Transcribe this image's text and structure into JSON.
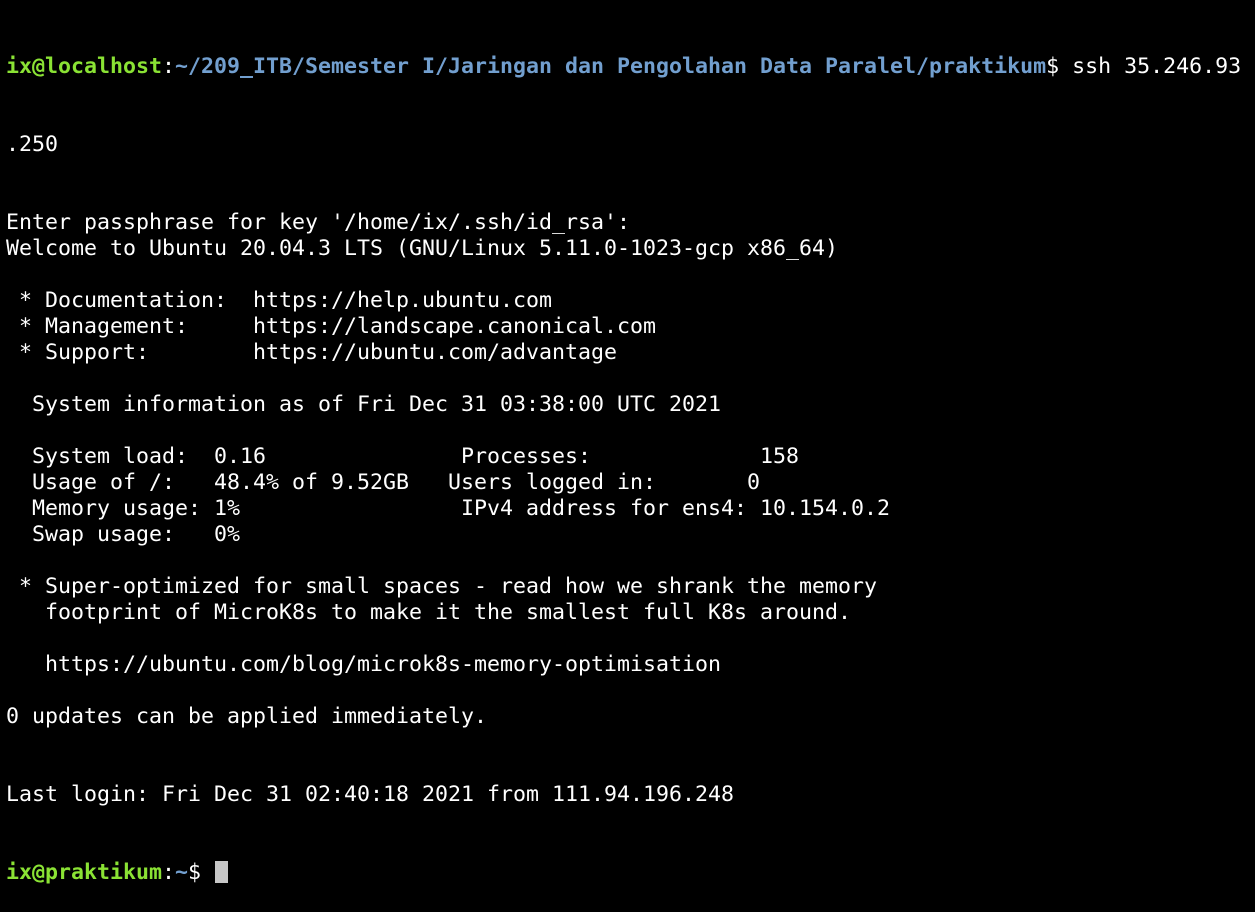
{
  "colors": {
    "background": "#000000",
    "foreground": "#ffffff",
    "prompt_user": "#8ae234",
    "prompt_path": "#729fcf",
    "cursor": "#c7c7c7"
  },
  "terminal": {
    "first_prompt": {
      "user_host": "ix@localhost",
      "separator": ":",
      "path": "~/209_ITB/Semester I/Jaringan dan Pengolahan Data Paralel/praktikum",
      "symbol": "$ ",
      "command": "ssh 35.246.93",
      "command_wrap": ".250"
    },
    "output_lines": [
      "Enter passphrase for key '/home/ix/.ssh/id_rsa':",
      "Welcome to Ubuntu 20.04.3 LTS (GNU/Linux 5.11.0-1023-gcp x86_64)",
      "",
      " * Documentation:  https://help.ubuntu.com",
      " * Management:     https://landscape.canonical.com",
      " * Support:        https://ubuntu.com/advantage",
      "",
      "  System information as of Fri Dec 31 03:38:00 UTC 2021",
      "",
      "  System load:  0.16               Processes:             158",
      "  Usage of /:   48.4% of 9.52GB   Users logged in:       0",
      "  Memory usage: 1%                 IPv4 address for ens4: 10.154.0.2",
      "  Swap usage:   0%",
      "",
      " * Super-optimized for small spaces - read how we shrank the memory",
      "   footprint of MicroK8s to make it the smallest full K8s around.",
      "",
      "   https://ubuntu.com/blog/microk8s-memory-optimisation",
      "",
      "0 updates can be applied immediately.",
      "",
      "",
      "Last login: Fri Dec 31 02:40:18 2021 from 111.94.196.248"
    ],
    "current_prompt": {
      "user_host": "ix@praktikum",
      "separator": ":",
      "path": "~",
      "symbol": "$ "
    }
  }
}
